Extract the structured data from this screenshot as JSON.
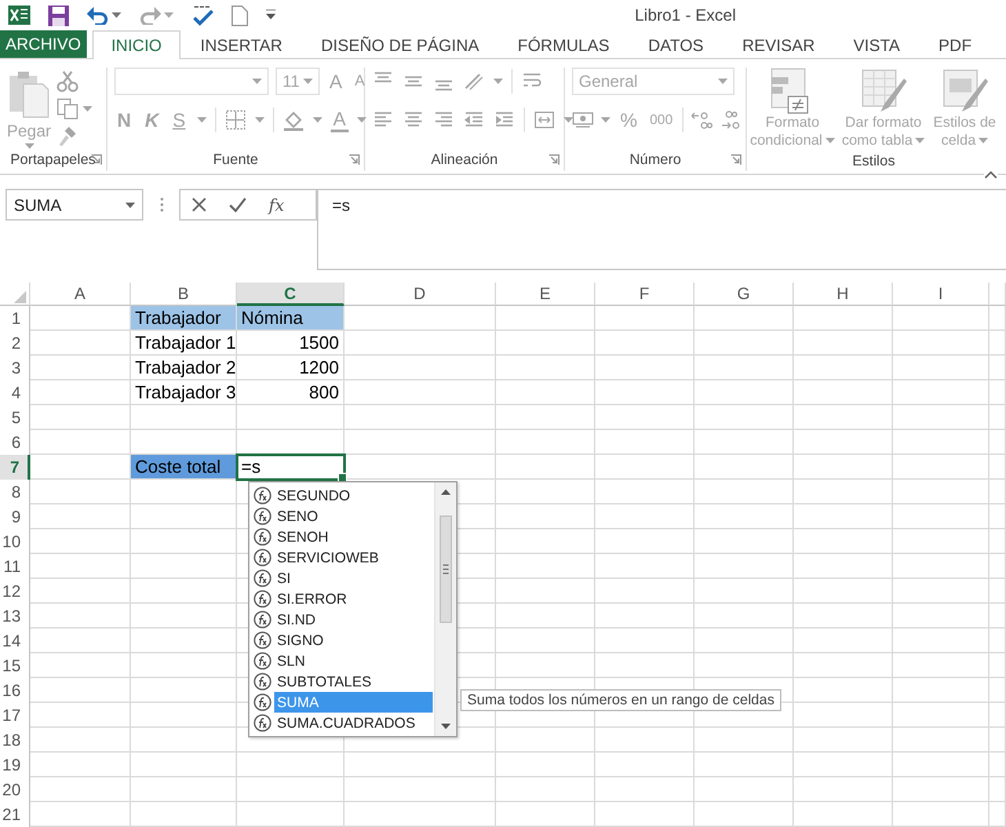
{
  "window": {
    "title": "Libro1 - Excel"
  },
  "tabs": [
    {
      "label": "ARCHIVO",
      "kind": "file",
      "selected": false
    },
    {
      "label": "INICIO",
      "kind": "tab",
      "selected": true
    },
    {
      "label": "INSERTAR",
      "kind": "tab",
      "selected": false
    },
    {
      "label": "DISEÑO DE PÁGINA",
      "kind": "tab",
      "selected": false
    },
    {
      "label": "FÓRMULAS",
      "kind": "tab",
      "selected": false
    },
    {
      "label": "DATOS",
      "kind": "tab",
      "selected": false
    },
    {
      "label": "REVISAR",
      "kind": "tab",
      "selected": false
    },
    {
      "label": "VISTA",
      "kind": "tab",
      "selected": false
    },
    {
      "label": "PDF",
      "kind": "tab",
      "selected": false
    }
  ],
  "ribbon": {
    "disabled": true,
    "groups": [
      {
        "kind": "clipboard",
        "label": "Portapapeles",
        "launcher": true,
        "paste": "Pegar"
      },
      {
        "kind": "font",
        "label": "Fuente",
        "launcher": true,
        "font_size": "11",
        "grow": "A",
        "shrink": "A",
        "bold": "N",
        "italic": "K",
        "underline": "S",
        "font_color": "A"
      },
      {
        "kind": "alignment",
        "label": "Alineación",
        "launcher": true
      },
      {
        "kind": "number",
        "label": "Número",
        "launcher": true,
        "format": "General",
        "percent": "%",
        "thousands": "000"
      },
      {
        "kind": "styles",
        "label": "Estilos",
        "launcher": false,
        "buttons": [
          "Formato condicional",
          "Dar formato como tabla",
          "Estilos de celda"
        ]
      }
    ]
  },
  "formula_bar": {
    "name_box": "SUMA",
    "function_button": "fx",
    "formula": "=s"
  },
  "sheet": {
    "columns": [
      {
        "label": "A",
        "selected": false
      },
      {
        "label": "B",
        "selected": false
      },
      {
        "label": "C",
        "selected": true
      },
      {
        "label": "D",
        "selected": false
      },
      {
        "label": "E",
        "selected": false
      },
      {
        "label": "F",
        "selected": false
      },
      {
        "label": "G",
        "selected": false
      },
      {
        "label": "H",
        "selected": false
      },
      {
        "label": "I",
        "selected": false
      }
    ],
    "rows": [
      {
        "label": "1",
        "selected": false,
        "cells": [
          null,
          {
            "text": "Trabajador",
            "kind": "text",
            "color": "#9dc3e6",
            "selected": false
          },
          {
            "text": "Nómina",
            "kind": "text",
            "color": "#9dc3e6",
            "selected": false
          }
        ]
      },
      {
        "label": "2",
        "selected": false,
        "cells": [
          null,
          {
            "text": "Trabajador 1",
            "kind": "text",
            "selected": false
          },
          {
            "text": "1500",
            "kind": "number",
            "selected": false
          }
        ]
      },
      {
        "label": "3",
        "selected": false,
        "cells": [
          null,
          {
            "text": "Trabajador 2",
            "kind": "text",
            "selected": false
          },
          {
            "text": "1200",
            "kind": "number",
            "selected": false
          }
        ]
      },
      {
        "label": "4",
        "selected": false,
        "cells": [
          null,
          {
            "text": "Trabajador 3",
            "kind": "text",
            "selected": false
          },
          {
            "text": "800",
            "kind": "number",
            "selected": false
          }
        ]
      },
      {
        "label": "5",
        "selected": false
      },
      {
        "label": "6",
        "selected": false
      },
      {
        "label": "7",
        "selected": true,
        "cells": [
          null,
          {
            "text": "Coste total",
            "kind": "text",
            "color": "#5f9bdc",
            "selected": false
          },
          {
            "text": "=s",
            "kind": "text",
            "selected": true
          }
        ]
      },
      {
        "label": "8",
        "selected": false
      },
      {
        "label": "9",
        "selected": false
      },
      {
        "label": "10",
        "selected": false
      },
      {
        "label": "11",
        "selected": false
      },
      {
        "label": "12",
        "selected": false
      },
      {
        "label": "13",
        "selected": false
      },
      {
        "label": "14",
        "selected": false
      },
      {
        "label": "15",
        "selected": false
      },
      {
        "label": "16",
        "selected": false
      },
      {
        "label": "17",
        "selected": false
      },
      {
        "label": "18",
        "selected": false
      },
      {
        "label": "19",
        "selected": false
      },
      {
        "label": "20",
        "selected": false
      },
      {
        "label": "21",
        "selected": false
      }
    ]
  },
  "autocomplete": {
    "items": [
      {
        "label": "SEGUNDO",
        "selected": false
      },
      {
        "label": "SENO",
        "selected": false
      },
      {
        "label": "SENOH",
        "selected": false
      },
      {
        "label": "SERVICIOWEB",
        "selected": false
      },
      {
        "label": "SI",
        "selected": false
      },
      {
        "label": "SI.ERROR",
        "selected": false
      },
      {
        "label": "SI.ND",
        "selected": false
      },
      {
        "label": "SIGNO",
        "selected": false
      },
      {
        "label": "SLN",
        "selected": false
      },
      {
        "label": "SUBTOTALES",
        "selected": false
      },
      {
        "label": "SUMA",
        "selected": true
      },
      {
        "label": "SUMA.CUADRADOS",
        "selected": false
      }
    ],
    "tooltip": "Suma todos los números en un rango de celdas"
  }
}
